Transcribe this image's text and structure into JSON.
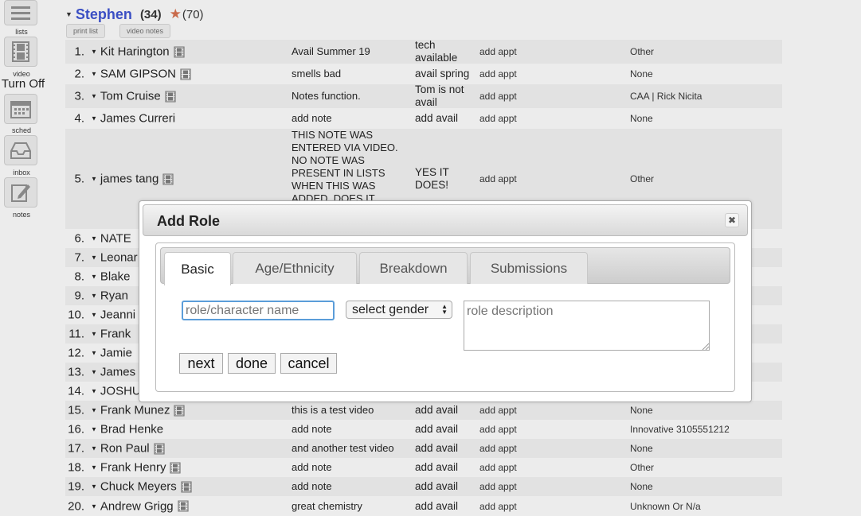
{
  "sidebar": {
    "items": [
      {
        "label": "lists",
        "icon": "hamburger-icon"
      },
      {
        "label": "video",
        "icon": "film-icon"
      },
      {
        "label": "sched",
        "icon": "calendar-icon"
      },
      {
        "label": "inbox",
        "icon": "inbox-icon"
      },
      {
        "label": "notes",
        "icon": "notepad-icon"
      }
    ],
    "turn_off": "Turn Off"
  },
  "header": {
    "name": "Stephen",
    "count": "(34)",
    "rating": "(70)",
    "print_list": "print list",
    "video_notes": "video notes"
  },
  "rows": [
    {
      "num": "1.",
      "name": "Kit Harington",
      "film": true,
      "note": "Avail Summer 19",
      "avail": "tech available",
      "appt": "add appt",
      "agency": "Other"
    },
    {
      "num": "2.",
      "name": "SAM GIPSON",
      "film": true,
      "note": "smells bad",
      "avail": "avail spring",
      "appt": "add appt",
      "agency": "None"
    },
    {
      "num": "3.",
      "name": "Tom Cruise",
      "film": true,
      "note": "Notes function.",
      "avail": "Tom is not avail",
      "appt": "add appt",
      "agency": "CAA | Rick Nicita"
    },
    {
      "num": "4.",
      "name": "James Curreri",
      "film": false,
      "note": "add note",
      "avail": "add avail",
      "appt": "add appt",
      "agency": "None"
    },
    {
      "num": "5.",
      "name": "james tang",
      "film": true,
      "note": "THIS NOTE WAS ENTERED VIA VIDEO. NO NOTE WAS PRESENT IN LISTS WHEN THIS WAS ADDED. DOES IT",
      "avail": "YES IT DOES!",
      "appt": "add appt",
      "agency": "Other"
    },
    {
      "num": "6.",
      "name": "NATE",
      "film": false,
      "note": "",
      "avail": "",
      "appt": "",
      "agency": ""
    },
    {
      "num": "7.",
      "name": "Leonar",
      "film": false,
      "note": "",
      "avail": "",
      "appt": "",
      "agency": ""
    },
    {
      "num": "8.",
      "name": "Blake",
      "film": false,
      "note": "",
      "avail": "",
      "appt": "",
      "agency": ""
    },
    {
      "num": "9.",
      "name": "Ryan",
      "film": false,
      "note": "",
      "avail": "",
      "appt": "",
      "agency": ""
    },
    {
      "num": "10.",
      "name": "Jeanni",
      "film": false,
      "note": "",
      "avail": "",
      "appt": "",
      "agency": ""
    },
    {
      "num": "11.",
      "name": "Frank",
      "film": false,
      "note": "",
      "avail": "",
      "appt": "",
      "agency": ""
    },
    {
      "num": "12.",
      "name": "Jamie",
      "film": false,
      "note": "",
      "avail": "",
      "appt": "",
      "agency": ""
    },
    {
      "num": "13.",
      "name": "James",
      "film": false,
      "note": "",
      "avail": "",
      "appt": "",
      "agency": ""
    },
    {
      "num": "14.",
      "name": "JOSHU",
      "film": false,
      "note": "",
      "avail": "",
      "appt": "",
      "agency": ""
    },
    {
      "num": "15.",
      "name": "Frank Munez",
      "film": true,
      "note": "this is a test video",
      "avail": "add avail",
      "appt": "add appt",
      "agency": "None"
    },
    {
      "num": "16.",
      "name": "Brad Henke",
      "film": false,
      "note": "add note",
      "avail": "add avail",
      "appt": "add appt",
      "agency": "Innovative  3105551212"
    },
    {
      "num": "17.",
      "name": "Ron Paul",
      "film": true,
      "note": "and another test video",
      "avail": "add avail",
      "appt": "add appt",
      "agency": "None"
    },
    {
      "num": "18.",
      "name": "Frank Henry",
      "film": true,
      "note": "add note",
      "avail": "add avail",
      "appt": "add appt",
      "agency": "Other"
    },
    {
      "num": "19.",
      "name": "Chuck Meyers",
      "film": true,
      "note": "add note",
      "avail": "add avail",
      "appt": "add appt",
      "agency": "None"
    },
    {
      "num": "20.",
      "name": "Andrew Grigg",
      "film": true,
      "note": "great chemistry",
      "avail": "add avail",
      "appt": "add appt",
      "agency": "Unknown Or N/a"
    }
  ],
  "modal": {
    "title": "Add Role",
    "close": "✖",
    "tabs": [
      "Basic",
      "Age/Ethnicity",
      "Breakdown",
      "Submissions"
    ],
    "role_placeholder": "role/character name",
    "gender_value": "select gender",
    "description_placeholder": "role description",
    "buttons": {
      "next": "next",
      "done": "done",
      "cancel": "cancel"
    }
  }
}
